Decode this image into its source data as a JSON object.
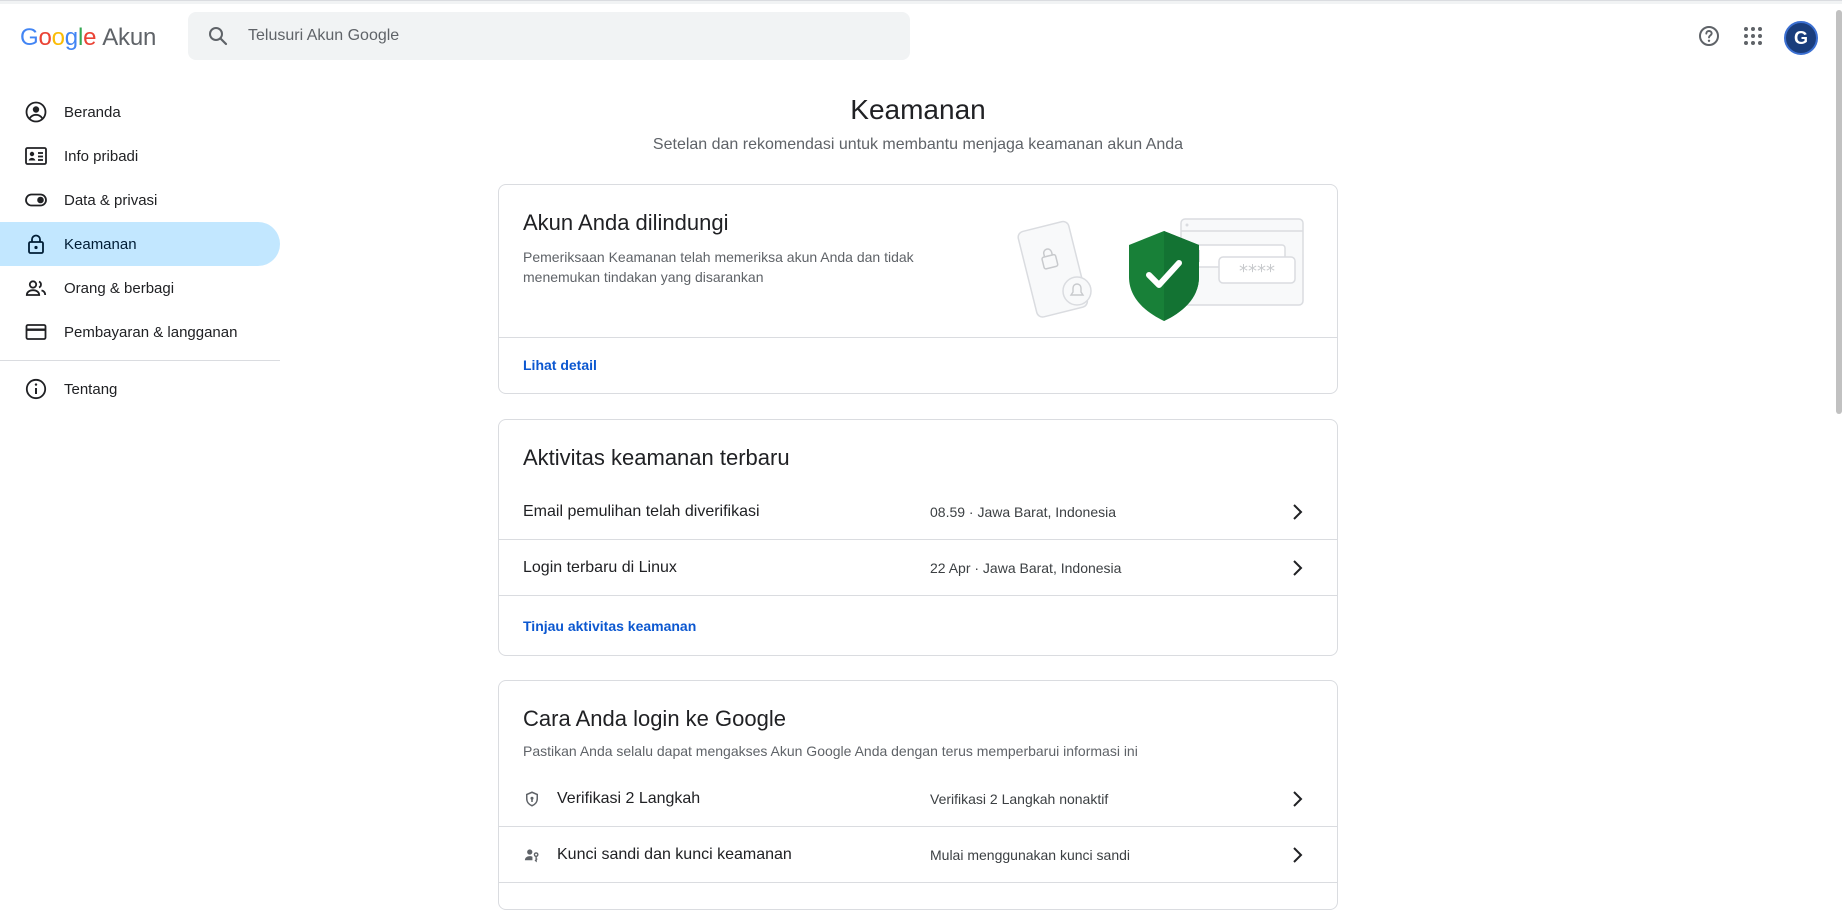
{
  "header": {
    "logo_google": [
      "G",
      "o",
      "o",
      "g",
      "l",
      "e"
    ],
    "logo_akun": "Akun",
    "search_placeholder": "Telusuri Akun Google",
    "avatar_letter": "G"
  },
  "sidebar": {
    "items": [
      {
        "label": "Beranda",
        "icon": "account-circle-icon"
      },
      {
        "label": "Info pribadi",
        "icon": "id-card-icon"
      },
      {
        "label": "Data & privasi",
        "icon": "toggle-icon"
      },
      {
        "label": "Keamanan",
        "icon": "lock-icon",
        "active": true
      },
      {
        "label": "Orang & berbagi",
        "icon": "people-icon"
      },
      {
        "label": "Pembayaran & langganan",
        "icon": "credit-card-icon"
      }
    ],
    "about": {
      "label": "Tentang",
      "icon": "info-icon"
    }
  },
  "main": {
    "title": "Keamanan",
    "subtitle": "Setelan dan rekomendasi untuk membantu menjaga keamanan akun Anda",
    "protected_card": {
      "title": "Akun Anda dilindungi",
      "desc": "Pemeriksaan Keamanan telah memeriksa akun Anda dan tidak menemukan tindakan yang disarankan",
      "link": "Lihat detail",
      "illustration_stars": "****"
    },
    "activity_card": {
      "title": "Aktivitas keamanan terbaru",
      "rows": [
        {
          "label": "Email pemulihan telah diverifikasi",
          "value": "08.59 · Jawa Barat, Indonesia"
        },
        {
          "label": "Login terbaru di Linux",
          "value": "22 Apr · Jawa Barat, Indonesia"
        }
      ],
      "link": "Tinjau aktivitas keamanan"
    },
    "signin_card": {
      "title": "Cara Anda login ke Google",
      "desc": "Pastikan Anda selalu dapat mengakses Akun Google Anda dengan terus memperbarui informasi ini",
      "rows": [
        {
          "label": "Verifikasi 2 Langkah",
          "value": "Verifikasi 2 Langkah nonaktif",
          "icon": "shield-icon"
        },
        {
          "label": "Kunci sandi dan kunci keamanan",
          "value": "Mulai menggunakan kunci sandi",
          "icon": "passkey-person-icon"
        }
      ]
    }
  },
  "colors": {
    "accent": "#0b57d0",
    "active_nav": "#c2e7ff",
    "shield_green": "#188038",
    "google_blue": "#4285F4",
    "google_red": "#EA4335",
    "google_yellow": "#FBBC05",
    "google_green": "#34A853"
  }
}
